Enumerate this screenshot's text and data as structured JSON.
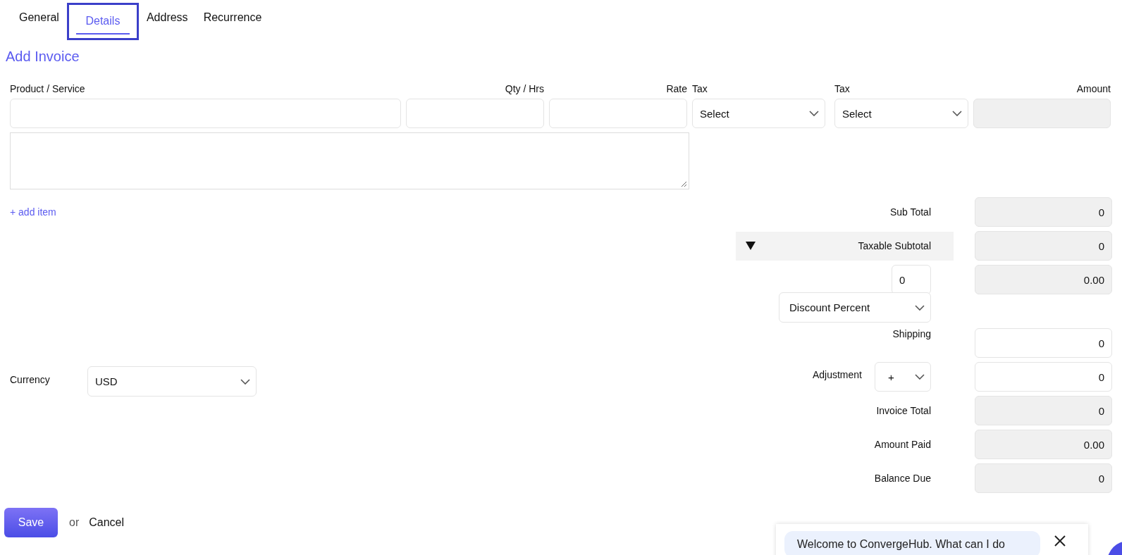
{
  "tabs": [
    {
      "label": "General",
      "selected": false
    },
    {
      "label": "Details",
      "selected": true
    },
    {
      "label": "Address",
      "selected": false
    },
    {
      "label": "Recurrence",
      "selected": false
    }
  ],
  "title": "Add Invoice",
  "line_item": {
    "columns": [
      {
        "kind": "text",
        "label": "Product / Service"
      },
      {
        "kind": "number",
        "label": "Qty / Hrs"
      },
      {
        "kind": "number",
        "label": "Rate"
      },
      {
        "kind": "select",
        "label": "Tax",
        "value": "Select"
      },
      {
        "kind": "select",
        "label": "Tax",
        "value": "Select"
      },
      {
        "kind": "amount",
        "label": "Amount"
      }
    ]
  },
  "add_item_link": "+ add item",
  "currency": {
    "label": "Currency",
    "value": "USD"
  },
  "summary": [
    {
      "kind": "readonly",
      "label": "Sub Total",
      "value": "0"
    },
    {
      "kind": "collapsible",
      "label": "Taxable Subtotal",
      "value": "0",
      "expanded": true
    },
    {
      "kind": "discount",
      "input": "0",
      "value": "0.00",
      "type": "Discount Percent"
    },
    {
      "kind": "input",
      "label": "Shipping",
      "value": "0"
    },
    {
      "kind": "adjustment",
      "label": "Adjustment",
      "sign": "+",
      "value": "0"
    },
    {
      "kind": "readonly",
      "label": "Invoice Total",
      "value": "0"
    },
    {
      "kind": "readonly",
      "label": "Amount Paid",
      "value": "0.00"
    },
    {
      "kind": "readonly",
      "label": "Balance Due",
      "value": "0"
    }
  ],
  "actions": {
    "save": "Save",
    "separator": "or",
    "cancel": "Cancel"
  },
  "chat": {
    "message": "Welcome to ConvergeHub. What can I do"
  }
}
